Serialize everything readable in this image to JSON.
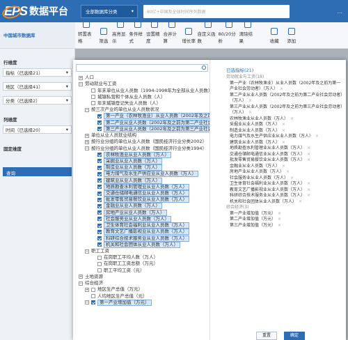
{
  "header": {
    "logo": "EPS",
    "platform": "数据平台",
    "category_button": "全部数据库分类",
    "search_placeholder": "80亿+中国及全球时间序列数据",
    "more": "..."
  },
  "db_title": "中国城市数据库",
  "toolbar": [
    "转置表格",
    "筛选",
    "高亮显示",
    "条件样式",
    "设置精度",
    "合并计算",
    "增长率",
    "自定义函数",
    "80/20分析",
    "清除结果",
    "收藏",
    "添加"
  ],
  "left": {
    "row_dim": "行维度",
    "row_fields": [
      {
        "label": "指标（已选择21）"
      },
      {
        "label": "地区（已选择41）"
      },
      {
        "label": "分类（已选择2）"
      }
    ],
    "col_dim": "列维度",
    "col_fields": [
      {
        "label": "时间（已选择20）"
      }
    ],
    "fixed_dim": "固定维度",
    "query": "查询"
  },
  "tree": [
    {
      "d": 0,
      "t": "+",
      "text": "人口"
    },
    {
      "d": 0,
      "t": "-",
      "text": "劳动就业与工资"
    },
    {
      "d": 1,
      "c": 1,
      "text": "年末单位从业人员数（1994-1998年为全部从业人员数）（万人）"
    },
    {
      "d": 1,
      "c": 1,
      "text": "城镇私营和个体从业人员数（人）"
    },
    {
      "d": 1,
      "c": 1,
      "text": "年末城镇登记失业人员数（人）"
    },
    {
      "d": 1,
      "t": "-",
      "text": "按三次产业的单位从业人员数状况"
    },
    {
      "d": 2,
      "c": 1,
      "s": 1,
      "text": "第一产业（农林牧渔业）从业人员数（2002年及之前为第一产业社会劳动者）（万人）"
    },
    {
      "d": 2,
      "c": 1,
      "s": 1,
      "text": "第二产业从业人员数（2002年及之前为第二产业社会劳动者）（万人）"
    },
    {
      "d": 2,
      "c": 1,
      "s": 1,
      "text": "第三产业从业人员数（2002年及之前为第三产业社会劳动者）（万人）"
    },
    {
      "d": 1,
      "t": "+",
      "text": "单位从业人员就业结构"
    },
    {
      "d": 1,
      "t": "+",
      "text": "按行业分组的单位从业人员数（国民经济行业分类2002）"
    },
    {
      "d": 1,
      "t": "-",
      "text": "按行业分组的单位从业人员数（国民经济行业分类1994）"
    },
    {
      "d": 2,
      "c": 1,
      "s": 1,
      "text": "农林牧渔业从业人员数（万人）"
    },
    {
      "d": 2,
      "c": 1,
      "s": 1,
      "text": "采掘业从业人员数（万人）"
    },
    {
      "d": 2,
      "c": 1,
      "s": 1,
      "text": "制造业从业人员数（万人）"
    },
    {
      "d": 2,
      "c": 1,
      "s": 1,
      "text": "电力煤气及水生产供应业从业人员数（万人）"
    },
    {
      "d": 2,
      "c": 1,
      "s": 1,
      "text": "建筑业从业人员数（万人）"
    },
    {
      "d": 2,
      "c": 1,
      "s": 1,
      "text": "地质勘查水利管理业从业人员数（万人）"
    },
    {
      "d": 2,
      "c": 1,
      "s": 1,
      "text": "交通仓储邮电通信业从业人员数（万人）"
    },
    {
      "d": 2,
      "c": 1,
      "s": 1,
      "text": "批发零售贸易餐饮业从业人员数（万人）"
    },
    {
      "d": 2,
      "c": 1,
      "s": 1,
      "text": "金融业从业人员数（万人）"
    },
    {
      "d": 2,
      "c": 1,
      "s": 1,
      "text": "房地产业从业人员数（万人）"
    },
    {
      "d": 2,
      "c": 1,
      "s": 1,
      "text": "社会服务业从业人员数（万人）"
    },
    {
      "d": 2,
      "c": 1,
      "s": 1,
      "text": "卫生体育社会福利业从业人员数（万人）"
    },
    {
      "d": 2,
      "c": 1,
      "s": 1,
      "text": "教育文艺广播影视业从业人员数（万人）"
    },
    {
      "d": 2,
      "c": 1,
      "s": 1,
      "text": "科研综合技术服务业从业人员数（万人）"
    },
    {
      "d": 2,
      "c": 1,
      "s": 1,
      "text": "机关和社会团体从业人员数（万人）"
    },
    {
      "d": 1,
      "t": "-",
      "text": "职工工资"
    },
    {
      "d": 2,
      "c": 1,
      "text": "在岗职工平均人数（万人）"
    },
    {
      "d": 2,
      "c": 1,
      "text": "在岗职工工资总额（万元）"
    },
    {
      "d": 2,
      "c": 1,
      "text": "职工平均工资（元）"
    },
    {
      "d": 0,
      "t": "+",
      "text": "土地资源"
    },
    {
      "d": 0,
      "t": "-",
      "text": "综合经济"
    },
    {
      "d": 1,
      "t": "+",
      "c": 1,
      "text": "地区生产总值（万元）"
    },
    {
      "d": 1,
      "c": 1,
      "text": "人均地区生产总值（元）"
    },
    {
      "d": 1,
      "t": "-",
      "c": 1,
      "s": 1,
      "text": "第一产业增加值（万元）"
    }
  ],
  "selected": {
    "header": "已选指标(21)",
    "items": [
      {
        "g": 1,
        "text": "劳动就业与工资(18)"
      },
      {
        "text": "第一产业（农林牧渔业）从业人员数（2002年及之前为第一产业社会劳动者）（万人）",
        "x": 1
      },
      {
        "text": "第二产业从业人员数（2002年及之前为第二产业社会劳动者）（万人）",
        "x": 1
      },
      {
        "text": "第三产业从业人员数（2002年及之前为第三产业社会劳动者）（万人）",
        "x": 1
      },
      {
        "text": "农林牧渔业从业人员数（万人）",
        "x": 1
      },
      {
        "text": "采掘业从业人员数（万人）",
        "x": 1
      },
      {
        "text": "制造业从业人员数（万人）",
        "x": 1
      },
      {
        "text": "电力煤气及水生产供应业从业人员数（万人）",
        "x": 1
      },
      {
        "text": "建筑业从业人员数（万人）",
        "x": 1
      },
      {
        "text": "地质勘查水利管理业从业人员数（万人）",
        "x": 1
      },
      {
        "text": "交通仓储邮电通信业从业人员数（万人）",
        "x": 1
      },
      {
        "text": "批发零售贸易餐饮业从业人员数（万人）",
        "x": 1
      },
      {
        "text": "金融业从业人员数（万人）",
        "x": 1
      },
      {
        "text": "房地产业从业人员数（万人）",
        "x": 1
      },
      {
        "text": "社会服务业从业人员数（万人）",
        "x": 1
      },
      {
        "text": "卫生体育社会福利业从业人员数（万人）",
        "x": 1
      },
      {
        "text": "教育文艺广播影视业从业人员数（万人）",
        "x": 1
      },
      {
        "text": "科研综合技术服务业从业人员数（万人）",
        "x": 1
      },
      {
        "text": "机关和社会团体从业人员数（万人）",
        "x": 1
      },
      {
        "g": 1,
        "text": "综合经济(3)"
      },
      {
        "text": "第一产业增加值（万元）",
        "x": 1
      },
      {
        "text": "第二产业增加值（万元）",
        "x": 1
      },
      {
        "text": "第三产业增加值（万元）",
        "x": 1
      }
    ],
    "reset": "重置",
    "confirm": "确定"
  }
}
